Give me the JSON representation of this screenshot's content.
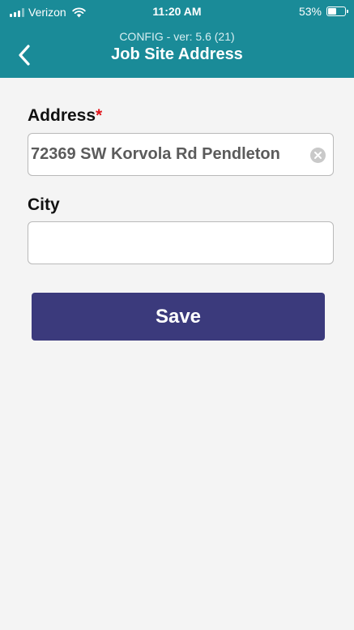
{
  "status_bar": {
    "carrier": "Verizon",
    "time": "11:20 AM",
    "battery_percent": "53%",
    "battery_level": 0.53
  },
  "header": {
    "version": "CONFIG - ver: 5.6 (21)",
    "title": "Job Site Address",
    "background_color": "#1a8b98"
  },
  "form": {
    "address": {
      "label": "Address",
      "required_marker": "*",
      "value": "72369 SW Korvola Rd Pendleton"
    },
    "city": {
      "label": "City",
      "value": ""
    }
  },
  "save_button": {
    "label": "Save",
    "color": "#3b3a7c"
  },
  "icons": {
    "back": "chevron-left-icon",
    "clear": "clear-circle-icon",
    "wifi": "wifi-icon",
    "signal": "cellular-signal-icon",
    "battery": "battery-icon"
  }
}
